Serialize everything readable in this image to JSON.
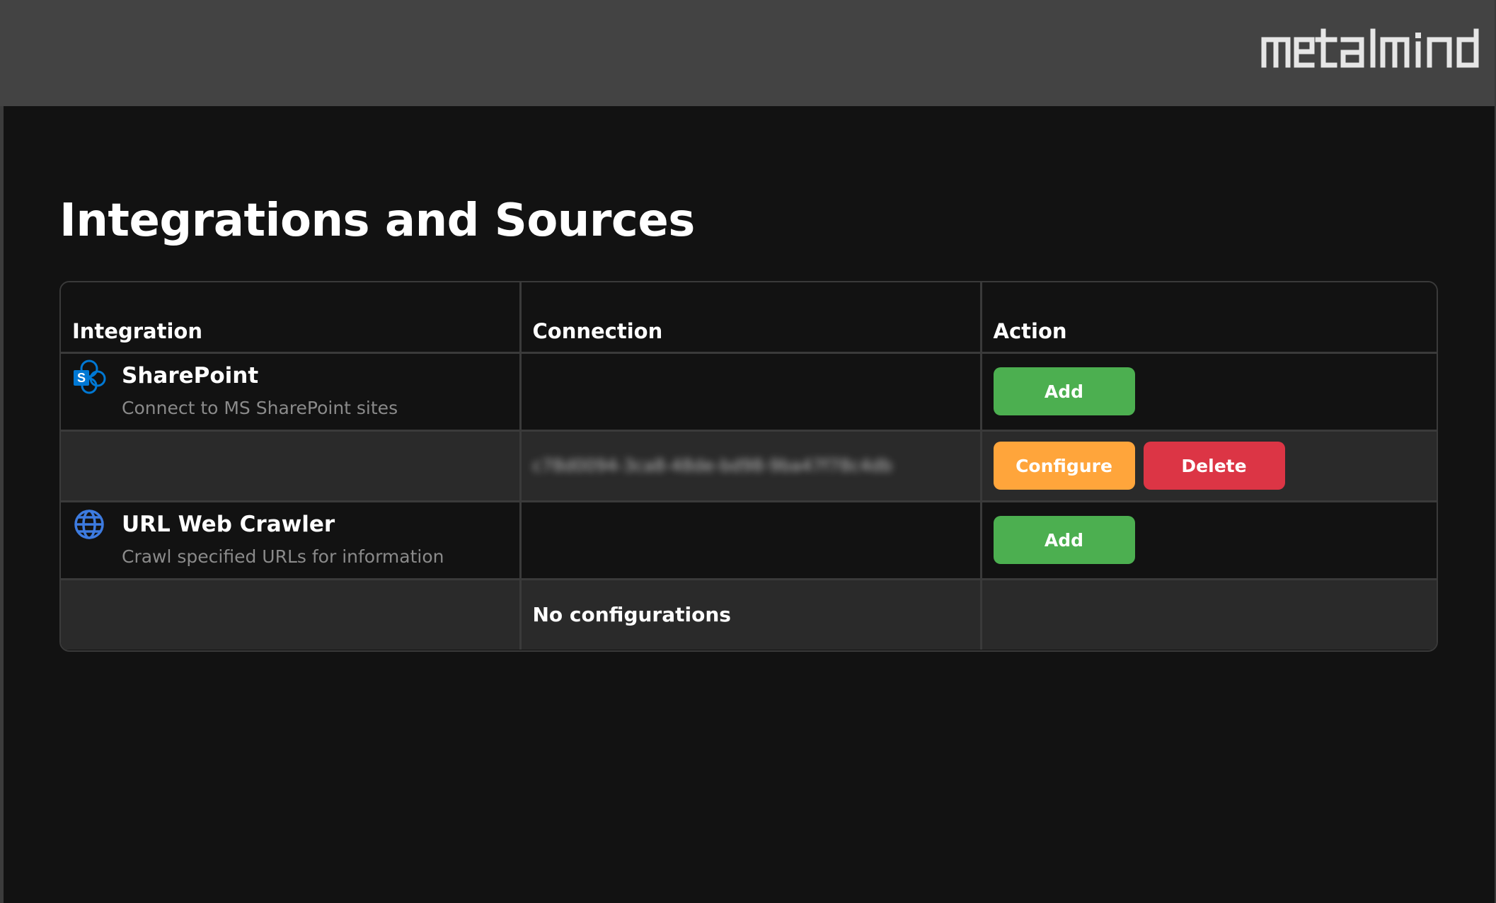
{
  "brand": {
    "logo_text": "metalmind"
  },
  "page": {
    "title": "Integrations and Sources"
  },
  "table": {
    "headers": {
      "integration": "Integration",
      "connection": "Connection",
      "action": "Action"
    },
    "integrations": [
      {
        "name": "SharePoint",
        "description": "Connect to MS SharePoint sites",
        "icon": "sharepoint-icon",
        "add_label": "Add",
        "configurations": [
          {
            "connection_id": "c78d0094-3ca8-48de-bd98-9ba47f78c4db",
            "configure_label": "Configure",
            "delete_label": "Delete"
          }
        ]
      },
      {
        "name": "URL Web Crawler",
        "description": "Crawl specified URLs for information",
        "icon": "globe-icon",
        "add_label": "Add",
        "empty_text": "No configurations"
      }
    ]
  },
  "colors": {
    "header_bg": "#434343",
    "page_bg": "#121212",
    "sub_row_bg": "#2a2a2a",
    "add": "#4caf50",
    "configure": "#ffa53b",
    "delete": "#dc3545",
    "sharepoint": "#0078d4",
    "globe": "#3d7be0"
  }
}
